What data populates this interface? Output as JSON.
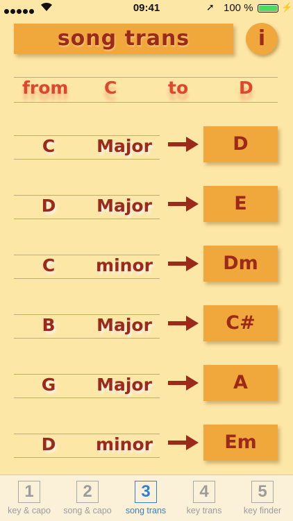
{
  "status": {
    "time": "09:41",
    "battery": "100 %"
  },
  "header": {
    "title": "song trans",
    "info_label": "i"
  },
  "transpose": {
    "from_label": "from",
    "from_key": "C",
    "to_label": "to",
    "to_key": "D"
  },
  "rows": [
    {
      "root": "C",
      "quality": "Major",
      "result": "D"
    },
    {
      "root": "D",
      "quality": "Major",
      "result": "E"
    },
    {
      "root": "C",
      "quality": "minor",
      "result": "Dm"
    },
    {
      "root": "B",
      "quality": "Major",
      "result": "C#"
    },
    {
      "root": "G",
      "quality": "Major",
      "result": "A"
    },
    {
      "root": "D",
      "quality": "minor",
      "result": "Em"
    }
  ],
  "tabs": [
    {
      "num": "1",
      "label": "key & capo"
    },
    {
      "num": "2",
      "label": "song & capo"
    },
    {
      "num": "3",
      "label": "song trans",
      "active": true
    },
    {
      "num": "4",
      "label": "key trans"
    },
    {
      "num": "5",
      "label": "key finder"
    }
  ],
  "colors": {
    "background": "#fde7a6",
    "button": "#f0a83c",
    "text": "#9b2a18",
    "header_text": "#e0452e",
    "active_tab": "#2f7fd8"
  }
}
